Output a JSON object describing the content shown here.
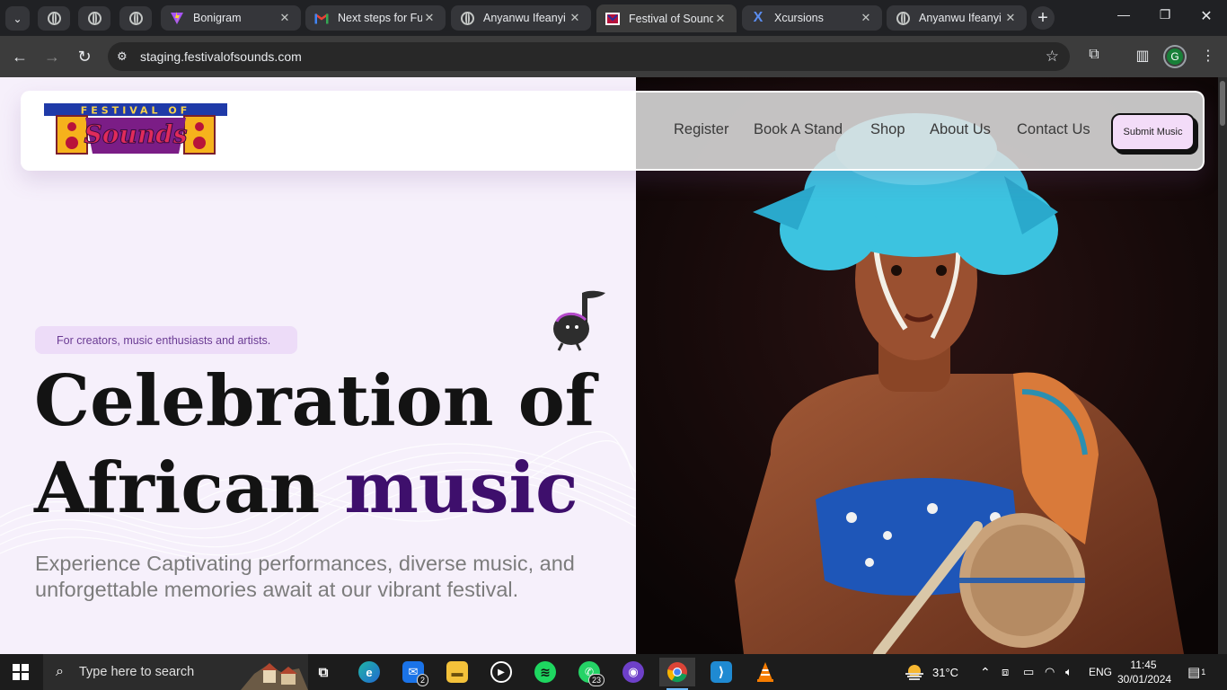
{
  "browser": {
    "pinned_tabs": [
      "globe-icon",
      "globe-icon",
      "globe-icon"
    ],
    "tabs": [
      {
        "title": "Bonigram",
        "icon": "vite-icon",
        "active": false
      },
      {
        "title": "Next steps for Fu",
        "icon": "gmail-icon",
        "active": false
      },
      {
        "title": "Anyanwu Ifeanyi",
        "icon": "globe-icon",
        "active": false
      },
      {
        "title": "Festival of Sound",
        "icon": "festival-icon",
        "active": true
      },
      {
        "title": "Xcursions",
        "icon": "xcursions-icon",
        "active": false
      },
      {
        "title": "Anyanwu Ifeanyi",
        "icon": "globe-icon",
        "active": false
      }
    ],
    "new_tab": "+",
    "address": "staging.festivalofsounds.com",
    "profile_initial": "G"
  },
  "site": {
    "logo_text_top": "FESTIVAL OF",
    "logo_text_main": "Sounds",
    "nav": [
      "Register",
      "Book A Stand",
      "Shop",
      "About Us",
      "Contact Us"
    ],
    "submit_label": "Submit Music",
    "tagline": "For creators, music enthusiasts and artists.",
    "headline_line1": "Celebration of",
    "headline_line2_plain": "African ",
    "headline_line2_accent": "music",
    "subtext": "Experience Captivating performances, diverse music, and unforgettable memories await at our vibrant festival.",
    "colors": {
      "accent": "#3e0f6c",
      "tagline_bg": "#eddcf8",
      "submit_bg": "#f3dcf8",
      "page_bg": "#f6f0fb"
    }
  },
  "taskbar": {
    "search_placeholder": "Type here to search",
    "apps": [
      {
        "name": "task-view-icon",
        "badge": ""
      },
      {
        "name": "edge-icon",
        "badge": ""
      },
      {
        "name": "mail-icon",
        "badge": "2"
      },
      {
        "name": "file-explorer-icon",
        "badge": ""
      },
      {
        "name": "media-player-icon",
        "badge": ""
      },
      {
        "name": "spotify-icon",
        "badge": ""
      },
      {
        "name": "whatsapp-icon",
        "badge": "23"
      },
      {
        "name": "github-icon",
        "badge": ""
      },
      {
        "name": "chrome-icon",
        "badge": ""
      },
      {
        "name": "vscode-icon",
        "badge": ""
      },
      {
        "name": "vlc-icon",
        "badge": ""
      }
    ],
    "weather": "31°C",
    "language": "ENG",
    "time": "11:45",
    "date": "30/01/2024",
    "notifications": "1"
  }
}
